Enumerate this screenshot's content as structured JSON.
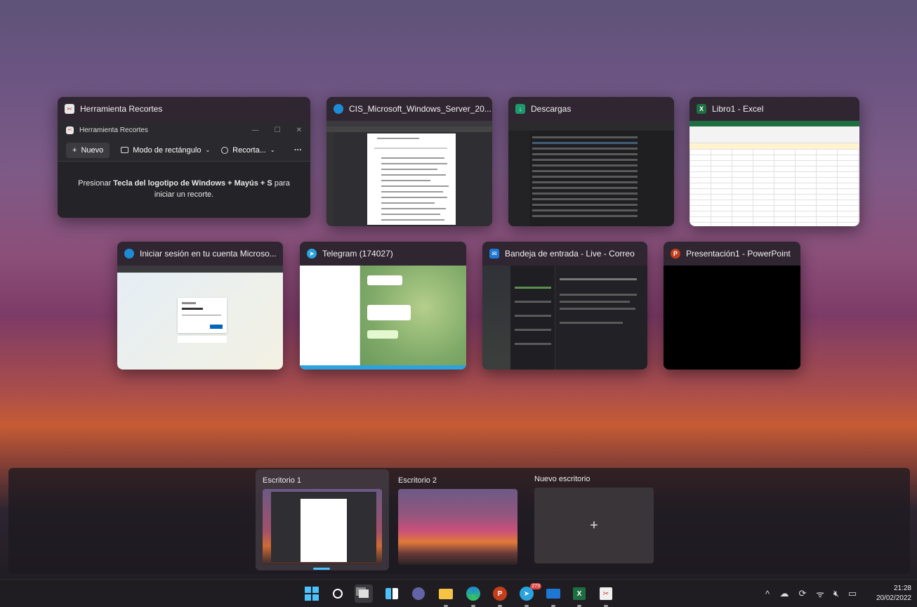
{
  "windows": {
    "snip": {
      "title": "Herramienta Recortes",
      "inner_title": "Herramienta Recortes",
      "new_label": "Nuevo",
      "mode_label": "Modo de rectángulo",
      "delay_label": "Recorta...",
      "more_label": "···",
      "hint_prefix": "Presionar ",
      "hint_bold": "Tecla del logotipo de Windows + Mayús + S",
      "hint_suffix": " para iniciar un recorte."
    },
    "edge_pdf": {
      "title": "CIS_Microsoft_Windows_Server_20..."
    },
    "explorer": {
      "title": "Descargas"
    },
    "excel": {
      "title": "Libro1 - Excel"
    },
    "edge_login": {
      "title": "Iniciar sesión en tu cuenta Microso..."
    },
    "telegram": {
      "title": "Telegram (174027)"
    },
    "mail": {
      "title": "Bandeja de entrada - Live - Correo"
    },
    "powerpoint": {
      "title": "Presentación1 - PowerPoint"
    }
  },
  "desktops": {
    "items": [
      {
        "label": "Escritorio 1"
      },
      {
        "label": "Escritorio 2"
      }
    ],
    "new_label": "Nuevo escritorio",
    "new_icon": "+"
  },
  "taskbar": {
    "icons": [
      "start-icon",
      "search-icon",
      "task-view-icon",
      "widgets-icon",
      "teams-chat-icon",
      "file-explorer-icon",
      "edge-icon",
      "powerpoint-icon",
      "telegram-icon",
      "mail-icon",
      "excel-icon",
      "snipping-tool-icon"
    ],
    "telegram_badge": "273",
    "tray_chevron": "^",
    "time": "21:28",
    "date": "20/02/2022"
  },
  "colors": {
    "accent": "#4cc2ff",
    "excel_green": "#1d6f42",
    "powerpoint_red": "#c43e1c",
    "edge_blue": "#1e8bd6"
  }
}
